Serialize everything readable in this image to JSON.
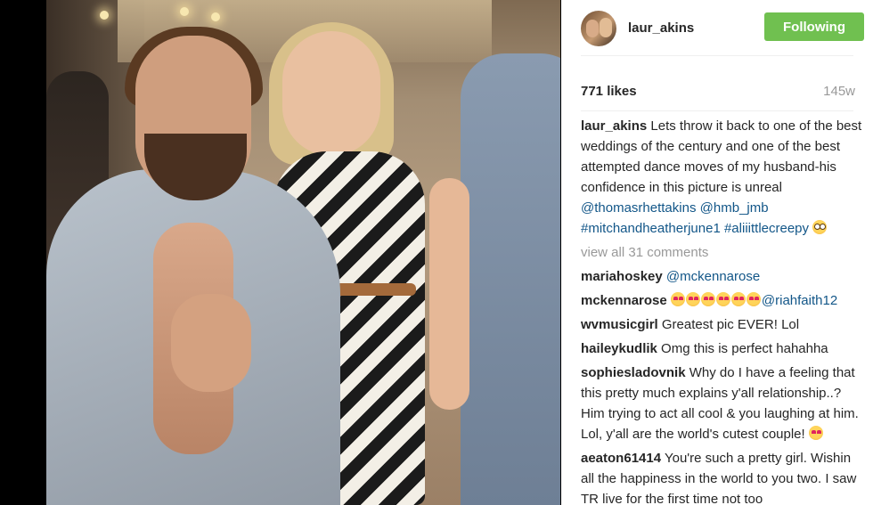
{
  "post": {
    "username": "laur_akins",
    "follow_label": "Following",
    "likes": "771 likes",
    "time": "145w"
  },
  "caption": {
    "username": "laur_akins",
    "text": " Lets throw it back to one of the best weddings of the century and one of the best attempted dance moves of my husband-his confidence in this picture is unreal ",
    "tags": [
      "@thomasrhettakins",
      "@hmb_jmb",
      "#mitchandheatherjune1",
      "#aliiittlecreepy"
    ],
    "emoji": "flushed-face-icon"
  },
  "view_all": "view all 31 comments",
  "comments": [
    {
      "user": "mariahoskey",
      "mention": "@mckennarose"
    },
    {
      "user": "mckennarose",
      "emoji": "heart-eyes-icon",
      "emoji_count": 6,
      "mention": "@riahfaith12"
    },
    {
      "user": "wvmusicgirl",
      "text": "Greatest pic EVER! Lol"
    },
    {
      "user": "haileykudlik",
      "text": "Omg this is perfect hahahha"
    },
    {
      "user": "sophiesladovnik",
      "text": "Why do I have a feeling that this pretty much explains y'all relationship..? Him trying to act all cool & you laughing at him. Lol, y'all are the world's cutest couple!",
      "emoji": "heart-eyes-icon"
    },
    {
      "user": "aeaton61414",
      "text": "You're such a pretty girl. Wishin all the happiness in the world to you two. I saw TR live for the first time not too"
    }
  ],
  "colors": {
    "follow_button": "#70c050",
    "link": "#125688",
    "muted": "#999999",
    "text": "#262626"
  }
}
